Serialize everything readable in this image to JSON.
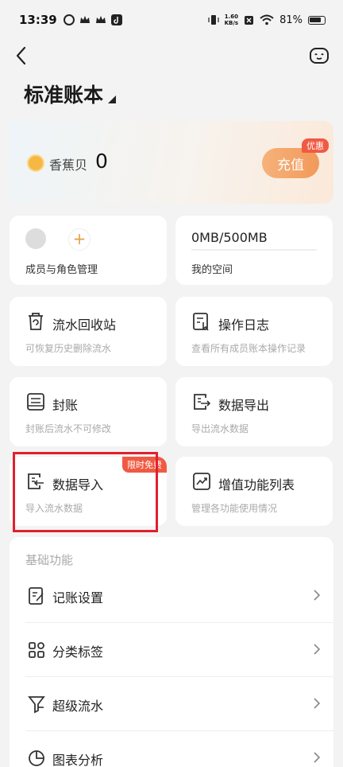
{
  "status_bar": {
    "time": "13:39",
    "net_speed_value": "1.60",
    "net_speed_unit": "KB/s",
    "battery": "81%"
  },
  "header": {
    "book_title": "标准账本"
  },
  "wallet": {
    "label": "香蕉贝",
    "value": "0",
    "recharge_label": "充值",
    "promo_badge": "优惠"
  },
  "members": {
    "label": "成员与角色管理"
  },
  "storage": {
    "usage": "0MB/500MB",
    "label": "我的空间",
    "fill_fraction": 0
  },
  "cards": [
    {
      "title": "流水回收站",
      "subtitle": "可恢复历史删除流水",
      "icon": "recycle-bin-icon"
    },
    {
      "title": "操作日志",
      "subtitle": "查看所有成员账本操作记录",
      "icon": "operation-log-icon"
    },
    {
      "title": "封账",
      "subtitle": "封账后流水不可修改",
      "icon": "seal-account-icon"
    },
    {
      "title": "数据导出",
      "subtitle": "导出流水数据",
      "icon": "data-export-icon"
    },
    {
      "title": "数据导入",
      "subtitle": "导入流水数据",
      "icon": "data-import-icon",
      "badge": "限时免费"
    },
    {
      "title": "增值功能列表",
      "subtitle": "管理各功能使用情况",
      "icon": "value-added-icon"
    }
  ],
  "basic": {
    "title": "基础功能",
    "items": [
      {
        "label": "记账设置",
        "icon": "bookkeeping-settings-icon"
      },
      {
        "label": "分类标签",
        "icon": "category-tags-icon"
      },
      {
        "label": "超级流水",
        "icon": "super-flow-icon"
      },
      {
        "label": "图表分析",
        "icon": "chart-analysis-icon"
      }
    ]
  },
  "colors": {
    "accent": "#f2995a",
    "badge": "#f05a43",
    "highlight": "#e0202e"
  }
}
